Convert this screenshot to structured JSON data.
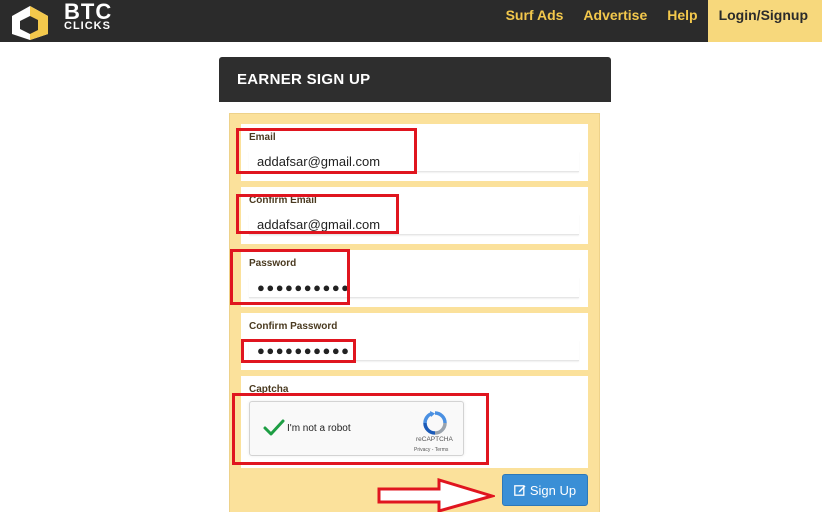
{
  "brand": {
    "line1": "BTC",
    "line2": "CLICKS",
    "logo_icon": "btc-clicks-logo-icon"
  },
  "nav": {
    "items": [
      "Surf Ads",
      "Advertise",
      "Help",
      "Login/Signup"
    ],
    "active": "Login/Signup"
  },
  "panel": {
    "title": "EARNER SIGN UP"
  },
  "form": {
    "email": {
      "label": "Email",
      "value": "addafsar@gmail.com"
    },
    "confirm_email": {
      "label": "Confirm Email",
      "value": "addafsar@gmail.com"
    },
    "password": {
      "label": "Password",
      "value": "●●●●●●●●●●"
    },
    "confirm_password": {
      "label": "Confirm Password",
      "value": "●●●●●●●●●●"
    },
    "captcha": {
      "label": "Captcha",
      "checkbox_text": "I'm not a robot",
      "brand": "reCAPTCHA",
      "links": "Privacy - Terms"
    },
    "submit_label": "Sign Up",
    "submit_icon": "edit-icon"
  },
  "colors": {
    "accent": "#f3c84c",
    "panel_bg": "#fbe19b",
    "button": "#3a8fd6",
    "annotation": "#e0151f"
  }
}
